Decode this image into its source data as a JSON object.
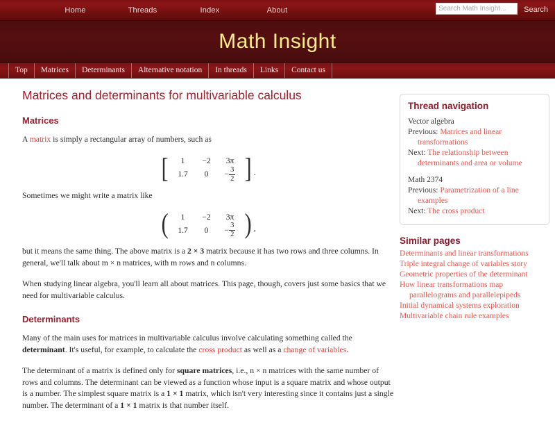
{
  "topnav": {
    "items": [
      {
        "label": "Home"
      },
      {
        "label": "Threads"
      },
      {
        "label": "Index"
      },
      {
        "label": "About"
      }
    ],
    "search": {
      "placeholder": "Search Math Insight...",
      "value": "",
      "button_label": "Search"
    }
  },
  "banner": {
    "title": "Math Insight",
    "title_color": "#ffec8b",
    "background_color": "#4d0d0e"
  },
  "subnav": {
    "items": [
      {
        "label": "Top"
      },
      {
        "label": "Matrices"
      },
      {
        "label": "Determinants"
      },
      {
        "label": "Alternative notation"
      },
      {
        "label": "In threads"
      },
      {
        "label": "Links"
      },
      {
        "label": "Contact us"
      }
    ]
  },
  "main": {
    "page_title": "Matrices and determinants for multivariable calculus",
    "sections": [
      {
        "heading": "Matrices",
        "p1_a": "A ",
        "p1_link": "matrix",
        "p1_b": " is simply a rectangular array of numbers, such as",
        "p2": "Sometimes we might write a matrix like",
        "p3_a": "but it means the same thing. The above matrix is a ",
        "p3_dim1": "2 × 3",
        "p3_b": " matrix because it has two rows and three columns. In general, we'll talk about ",
        "p3_dim2": "m × n",
        "p3_c": " matrices, with ",
        "p3_m": "m",
        "p3_d": " rows and ",
        "p3_n": "n",
        "p3_e": " columns.",
        "p4": "When studying linear algebra, you'll learn all about matrices. This page, though, covers just some basics that we need for multivariable calculus."
      },
      {
        "heading": "Determinants",
        "p1_a": "Many of the main uses for matrices in multivariable calculus involve calculating something called the ",
        "p1_bold": "determinant",
        "p1_b": ". It's useful, for example, to calculate the ",
        "p1_link1": "cross product",
        "p1_c": " as well as a ",
        "p1_link2": "change of variables",
        "p1_d": ".",
        "p2_a": "The determinant of a matrix is defined only for ",
        "p2_bold": "square matrices",
        "p2_b": ", i.e., ",
        "p2_nn": "n × n",
        "p2_c": " matrices with the same number of rows and columns. The determinant can be viewed as a function whose input is a square matrix and whose output is a number. The simplest square matrix is a ",
        "p2_11a": "1 × 1",
        "p2_d": " matrix, which isn't very interesting since it contains just a single number. The determinant of a ",
        "p2_11b": "1 × 1",
        "p2_e": " matrix is that number itself."
      }
    ],
    "matrices": [
      {
        "bracket_open": "[",
        "bracket_close": "]",
        "rows": [
          [
            "1",
            "−2",
            "3π"
          ],
          [
            "1.7",
            "0",
            "−3/2"
          ]
        ],
        "row2_col3_numerator": "3",
        "row2_col3_denominator": "2",
        "row2_col3_sign": "−",
        "punct": "."
      },
      {
        "bracket_open": "(",
        "bracket_close": ")",
        "rows": [
          [
            "1",
            "−2",
            "3π"
          ],
          [
            "1.7",
            "0",
            "−3/2"
          ]
        ],
        "row2_col3_numerator": "3",
        "row2_col3_denominator": "2",
        "row2_col3_sign": "−",
        "punct": ","
      }
    ]
  },
  "sidebar": {
    "thread_nav": {
      "title": "Thread navigation",
      "groups": [
        {
          "name": "Vector algebra",
          "previous_label": "Previous: ",
          "previous_link": "Matrices and linear transformations",
          "next_label": "Next: ",
          "next_link": "The relationship between determinants and area or volume"
        },
        {
          "name": "Math 2374",
          "previous_label": "Previous: ",
          "previous_link": "Parametrization of a line examples",
          "next_label": "Next: ",
          "next_link": "The cross product"
        }
      ]
    },
    "similar_pages": {
      "title": "Similar pages",
      "items": [
        "Determinants and linear transformations",
        "Triple integral change of variables story",
        "Geometric properties of the determinant",
        "How linear transformations map parallelograms and parallelepipeds",
        "Initial dynamical systems exploration",
        "Multivariable chain rule examples"
      ]
    }
  }
}
